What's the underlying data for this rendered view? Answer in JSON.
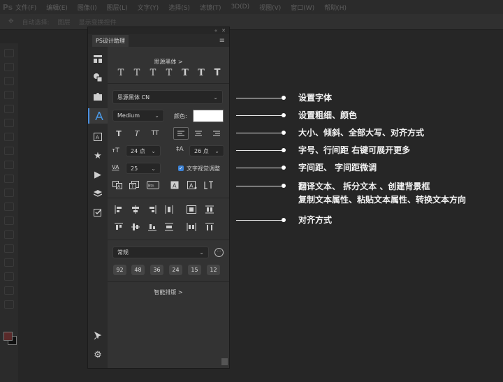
{
  "app": {
    "logo": "Ps",
    "menu": [
      "文件(F)",
      "编辑(E)",
      "图像(I)",
      "图层(L)",
      "文字(Y)",
      "选择(S)",
      "滤镜(T)",
      "3D(D)",
      "视图(V)",
      "窗口(W)",
      "帮助(H)"
    ],
    "options_bar": [
      "自动选择:",
      "图层",
      "显示变换控件"
    ]
  },
  "panel": {
    "title": "PS设计助理",
    "collapse_icon": "«",
    "close_icon": "✕",
    "menu_icon": "≡",
    "sidebar_icons": [
      "layout-icon",
      "shapes-icon",
      "puzzle-icon",
      "text-icon",
      "image-text-icon",
      "star-icon",
      "play-icon",
      "layers-icon",
      "check-icon",
      "pin-icon",
      "gear-icon"
    ],
    "font_preset_label": "思源黑体 >",
    "weights_preview": [
      "T",
      "T",
      "T",
      "T",
      "T",
      "T",
      "T"
    ],
    "font_family": "思源黑体 CN",
    "font_weight": "Medium",
    "color_label": "颜色:",
    "color_value": "#ffffff",
    "style_buttons": [
      "T",
      "T",
      "TT"
    ],
    "size_label": "24 点",
    "leading_label": "26 点",
    "tracking_value": "25",
    "optical_kerning_label": "文字视觉调整",
    "optical_kerning_checked": true,
    "text_tool_icons": [
      "translate-icon",
      "split-text-icon",
      "bg-frame-icon",
      "copy-style-icon",
      "paste-style-icon",
      "toggle-direction-icon"
    ],
    "preset_select": "常规",
    "more_icon": "···",
    "size_presets": [
      "92",
      "48",
      "36",
      "24",
      "15",
      "12"
    ],
    "smart_layout_label": "智能排版 >"
  },
  "annotations": [
    "设置字体",
    "设置粗细、颜色",
    "大小、倾斜、全部大写、对齐方式",
    "字号、行间距  右键可展开更多",
    "字间距、 字间距微调",
    "翻译文本、  拆分文本 、创建背景框",
    "复制文本属性、粘贴文本属性、转换文本方向",
    "对齐方式"
  ]
}
